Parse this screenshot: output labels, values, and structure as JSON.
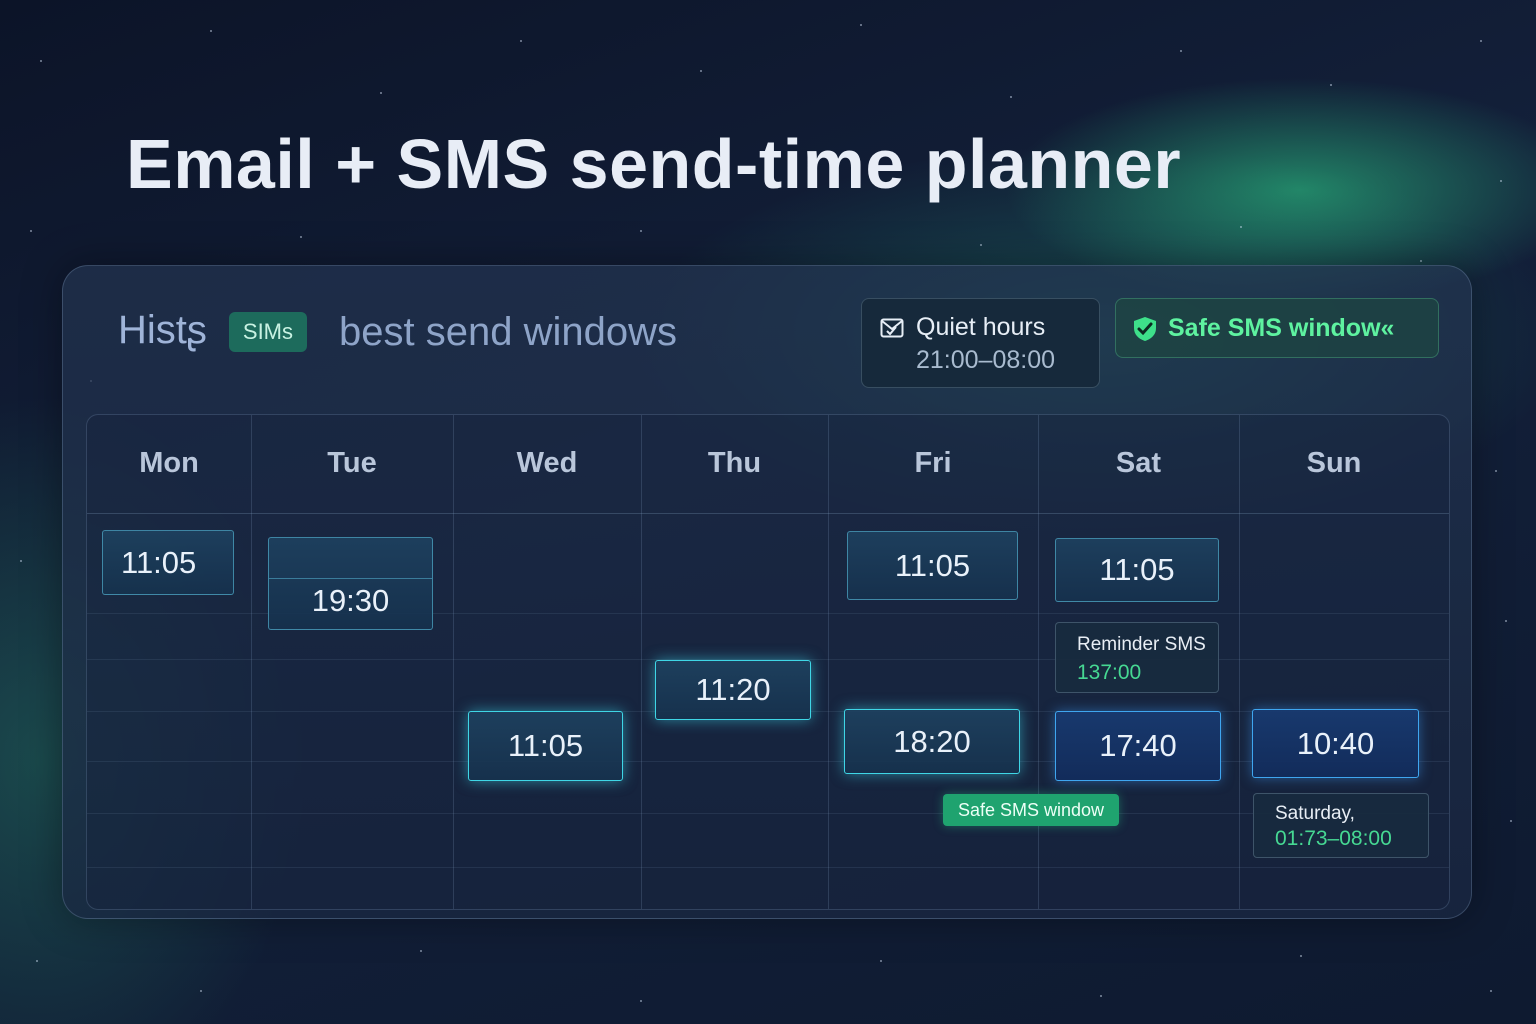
{
  "title": "Email + SMS send-time planner",
  "header": {
    "hist": "Histʂ",
    "sms_badge": "SIMs",
    "subtitle": "best send windows"
  },
  "quiet_hours": {
    "label": "Quiet hours",
    "value": "21:00–08:00",
    "icon": "envelope-check-icon"
  },
  "safe_window_chip": {
    "label": "Safe SMS window«",
    "icon": "shield-check-icon"
  },
  "days": [
    "Mon",
    "Tue",
    "Wed",
    "Thu",
    "Fri",
    "Sat",
    "Sun"
  ],
  "slots": {
    "mon_1": "11:05",
    "tue_1": "19:30",
    "wed_1": "11:05",
    "thu_1": "11:20",
    "fri_1": "11:05",
    "fri_2": "18:20",
    "sat_1": "11:05",
    "sat_2": "17:40",
    "sun_1": "10:40"
  },
  "reminder_note": {
    "line1": "Reminder SMS",
    "line2": "137:00"
  },
  "saturday_note": {
    "line1": "Saturday,",
    "line2": "01:73–08:00"
  },
  "safe_tag": "Safe SMS window",
  "colors": {
    "accent_green": "#46d893",
    "slot_border": "#3fd6e6",
    "blue_slot": "#3fa6f0",
    "badge": "#1d6b5c"
  }
}
